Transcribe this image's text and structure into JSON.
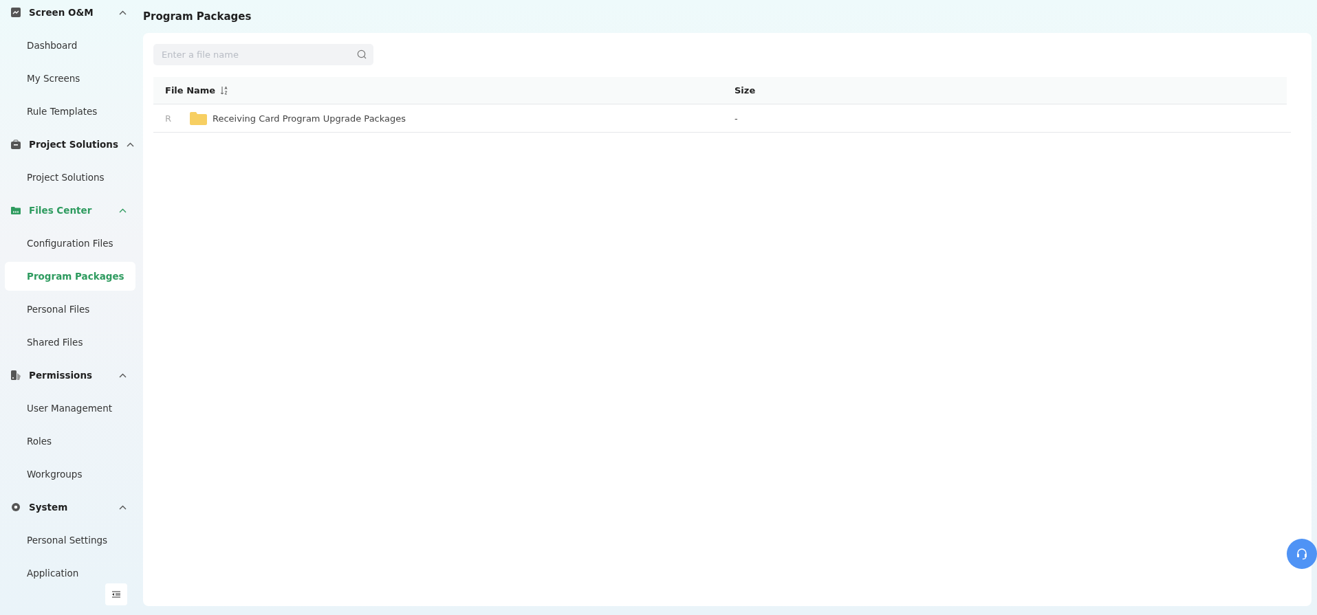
{
  "sidebar": {
    "sections": [
      {
        "kind": "chart",
        "label": "Screen O&M",
        "expanded": true,
        "items": [
          {
            "label": "Dashboard",
            "selected": false
          },
          {
            "label": "My Screens",
            "selected": false
          },
          {
            "label": "Rule Templates",
            "selected": false
          }
        ]
      },
      {
        "kind": "briefcase",
        "label": "Project Solutions",
        "expanded": true,
        "items": [
          {
            "label": "Project Solutions",
            "selected": false
          }
        ]
      },
      {
        "kind": "folder",
        "label": "Files Center",
        "expanded": true,
        "items": [
          {
            "label": "Configuration Files",
            "selected": false
          },
          {
            "label": "Program Packages",
            "selected": true
          },
          {
            "label": "Personal Files",
            "selected": false
          },
          {
            "label": "Shared Files",
            "selected": false
          }
        ]
      },
      {
        "kind": "permissions",
        "label": "Permissions",
        "expanded": true,
        "items": [
          {
            "label": "User Management",
            "selected": false
          },
          {
            "label": "Roles",
            "selected": false
          },
          {
            "label": "Workgroups",
            "selected": false
          }
        ]
      },
      {
        "kind": "gear",
        "label": "System",
        "expanded": true,
        "items": [
          {
            "label": "Personal Settings",
            "selected": false
          },
          {
            "label": "Application",
            "selected": false
          }
        ]
      }
    ]
  },
  "page": {
    "title": "Program Packages"
  },
  "search": {
    "placeholder": "Enter a file name"
  },
  "table": {
    "columns": [
      "File Name",
      "Size"
    ],
    "rows": [
      {
        "marker": "R",
        "name": "Receiving Card Program Upgrade Packages",
        "size": "-"
      }
    ]
  }
}
